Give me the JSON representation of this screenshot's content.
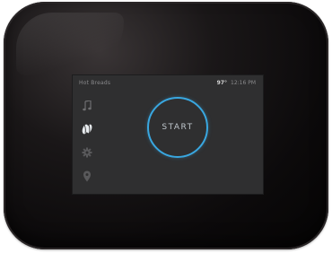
{
  "status": {
    "left_text": "Hot Breads",
    "temperature": "97°",
    "time": "12:16 PM"
  },
  "nav": [
    {
      "icon": "music-note-icon"
    },
    {
      "icon": "coffee-bean-icon",
      "active": true
    },
    {
      "icon": "gear-icon"
    },
    {
      "icon": "location-pin-icon"
    }
  ],
  "start": {
    "label": "START"
  },
  "colors": {
    "accent": "#39a7e0",
    "screen_bg": "#2f2f30",
    "bezel": "#0c0a0b"
  }
}
